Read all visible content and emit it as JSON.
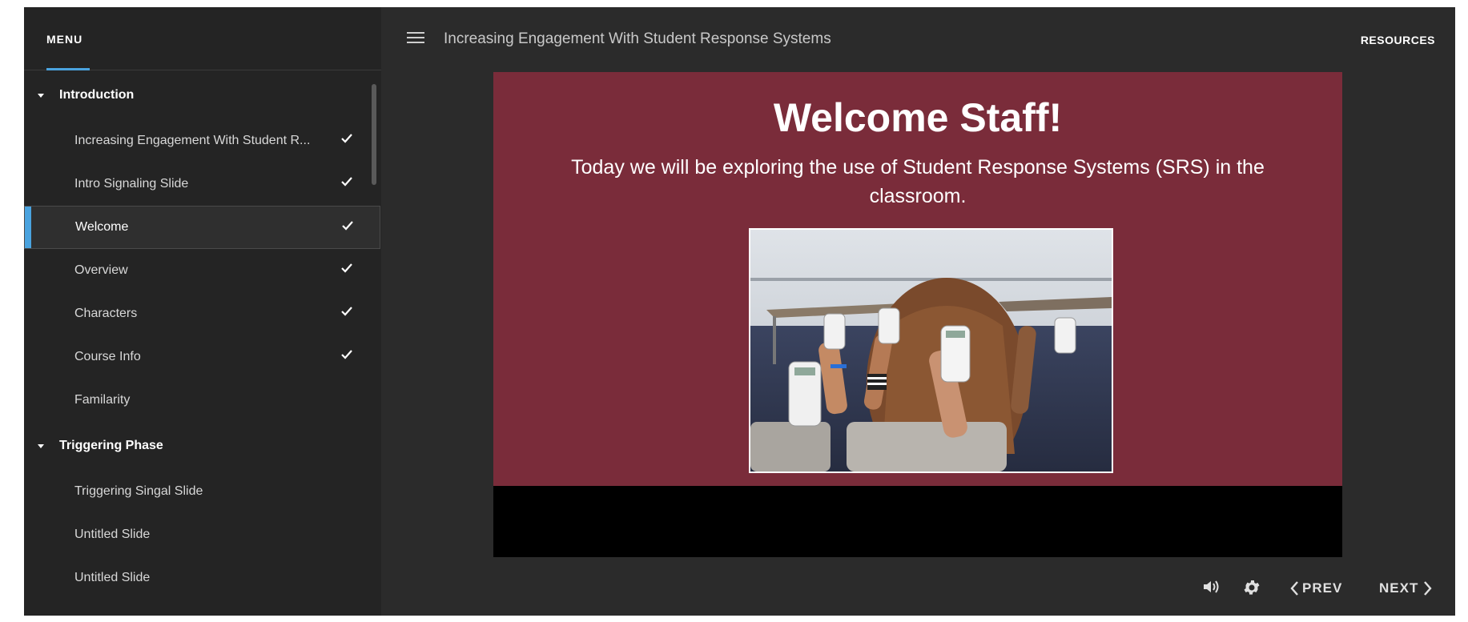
{
  "sidebar": {
    "menu_label": "MENU",
    "sections": [
      {
        "label": "Introduction",
        "items": [
          {
            "label": "Increasing Engagement With Student R...",
            "completed": true
          },
          {
            "label": "Intro Signaling Slide",
            "completed": true
          },
          {
            "label": "Welcome",
            "completed": true,
            "active": true
          },
          {
            "label": "Overview",
            "completed": true
          },
          {
            "label": "Characters",
            "completed": true
          },
          {
            "label": "Course Info",
            "completed": true
          },
          {
            "label": "Familarity",
            "completed": false
          }
        ]
      },
      {
        "label": "Triggering Phase",
        "items": [
          {
            "label": "Triggering Singal Slide",
            "completed": false
          },
          {
            "label": "Untitled Slide",
            "completed": false
          },
          {
            "label": "Untitled Slide",
            "completed": false
          }
        ]
      }
    ]
  },
  "topbar": {
    "course_title": "Increasing Engagement With Student Response Systems",
    "resources_label": "RESOURCES"
  },
  "slide": {
    "title": "Welcome Staff!",
    "subtitle": "Today we will be exploring the use of Student Response Systems (SRS) in the classroom.",
    "background_color": "#7a2c3a"
  },
  "controls": {
    "prev_label": "PREV",
    "next_label": "NEXT"
  },
  "colors": {
    "accent": "#4aa3df",
    "sidebar_bg": "#242424",
    "app_bg": "#2b2b2b"
  }
}
